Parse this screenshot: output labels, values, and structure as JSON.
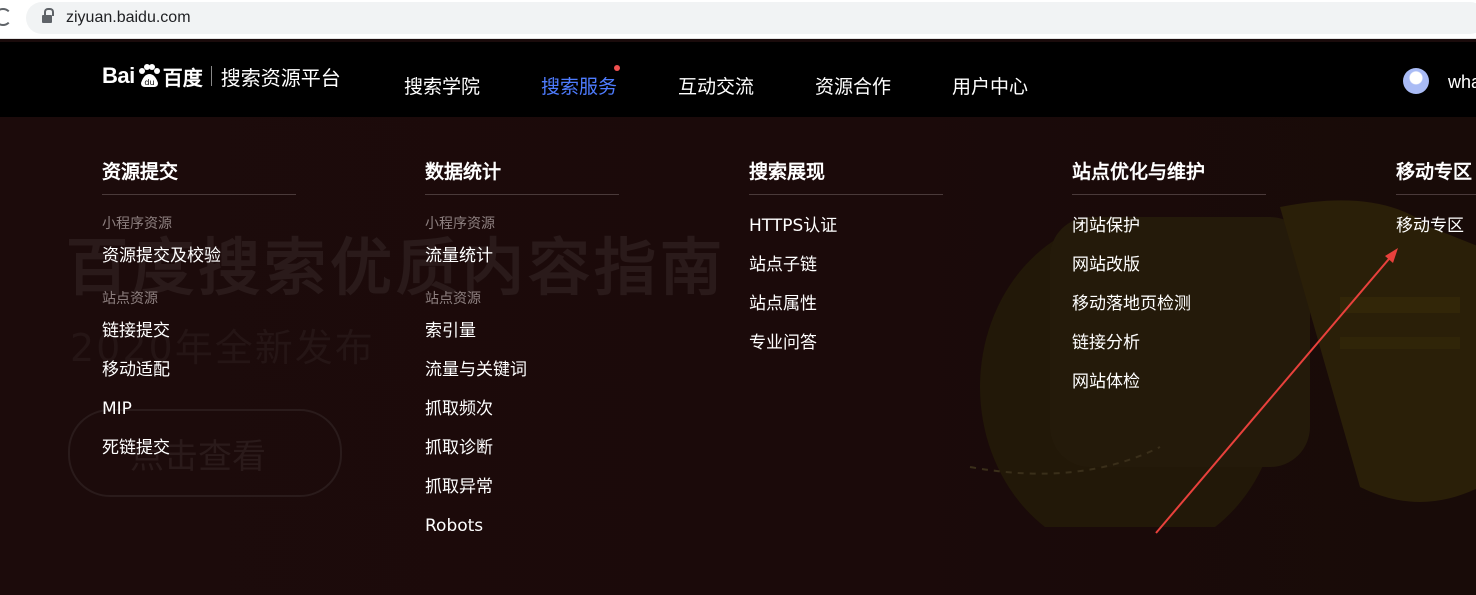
{
  "browser": {
    "url": "ziyuan.baidu.com"
  },
  "nav": {
    "logo_bai": "Bai",
    "logo_cn": "百度",
    "brand_sub": "搜索资源平台",
    "items": [
      {
        "label": "搜索学院"
      },
      {
        "label": "搜索服务"
      },
      {
        "label": "互动交流"
      },
      {
        "label": "资源合作"
      },
      {
        "label": "用户中心"
      }
    ],
    "user_name": "wha"
  },
  "banner": {
    "title": "百度搜索优质内容指南",
    "subtitle": "2020年全新发布",
    "button": "点击查看"
  },
  "menu": {
    "col1": {
      "title": "资源提交",
      "group1": "小程序资源",
      "group1_links": [
        "资源提交及校验"
      ],
      "group2": "站点资源",
      "group2_links": [
        "链接提交",
        "移动适配",
        "MIP",
        "死链提交"
      ]
    },
    "col2": {
      "title": "数据统计",
      "group1": "小程序资源",
      "group1_links": [
        "流量统计"
      ],
      "group2": "站点资源",
      "group2_links": [
        "索引量",
        "流量与关键词",
        "抓取频次",
        "抓取诊断",
        "抓取异常",
        "Robots"
      ]
    },
    "col3": {
      "title": "搜索展现",
      "links": [
        "HTTPS认证",
        "站点子链",
        "站点属性",
        "专业问答"
      ]
    },
    "col4": {
      "title": "站点优化与维护",
      "links": [
        "闭站保护",
        "网站改版",
        "移动落地页检测",
        "链接分析",
        "网站体检"
      ]
    },
    "col5": {
      "title": "移动专区",
      "links": [
        "移动专区"
      ]
    }
  },
  "colors": {
    "active_nav": "#4e7cff",
    "nav_dot": "#f0504f",
    "annotation_arrow": "#e8413c"
  }
}
